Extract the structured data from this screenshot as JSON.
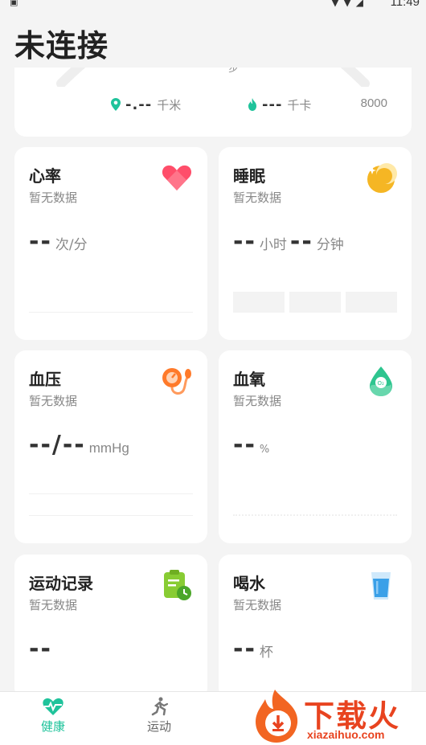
{
  "status_bar": {
    "time": "11:49"
  },
  "page_title": "未连接",
  "summary": {
    "steps_unit": "步",
    "distance_value": "-.--",
    "distance_unit": "千米",
    "calories_value": "---",
    "calories_unit": "千卡",
    "goal": "8000"
  },
  "cards": {
    "heart_rate": {
      "title": "心率",
      "status": "暂无数据",
      "value": "--",
      "unit": "次/分"
    },
    "sleep": {
      "title": "睡眠",
      "status": "暂无数据",
      "hours": "--",
      "hours_unit": "小时",
      "minutes": "--",
      "minutes_unit": "分钟"
    },
    "blood_pressure": {
      "title": "血压",
      "status": "暂无数据",
      "value": "--/--",
      "unit": "mmHg"
    },
    "blood_oxygen": {
      "title": "血氧",
      "status": "暂无数据",
      "value": "--",
      "unit": "%"
    },
    "exercise_record": {
      "title": "运动记录",
      "status": "暂无数据",
      "value": "--"
    },
    "water": {
      "title": "喝水",
      "status": "暂无数据",
      "value": "--",
      "unit": "杯"
    }
  },
  "tabs": [
    {
      "label": "健康",
      "icon": "heart-pulse-icon",
      "active": true
    },
    {
      "label": "运动",
      "icon": "running-icon",
      "active": false
    }
  ],
  "watermark": {
    "text": "下载火",
    "url": "xiazaihuo.com"
  },
  "colors": {
    "accent": "#1fc39b",
    "heart": "#ff4e6a",
    "sleep": "#f5b624",
    "pressure": "#ff7a2a",
    "oxygen": "#2ec58f",
    "exercise": "#88cc33",
    "water": "#3aa0e8"
  }
}
